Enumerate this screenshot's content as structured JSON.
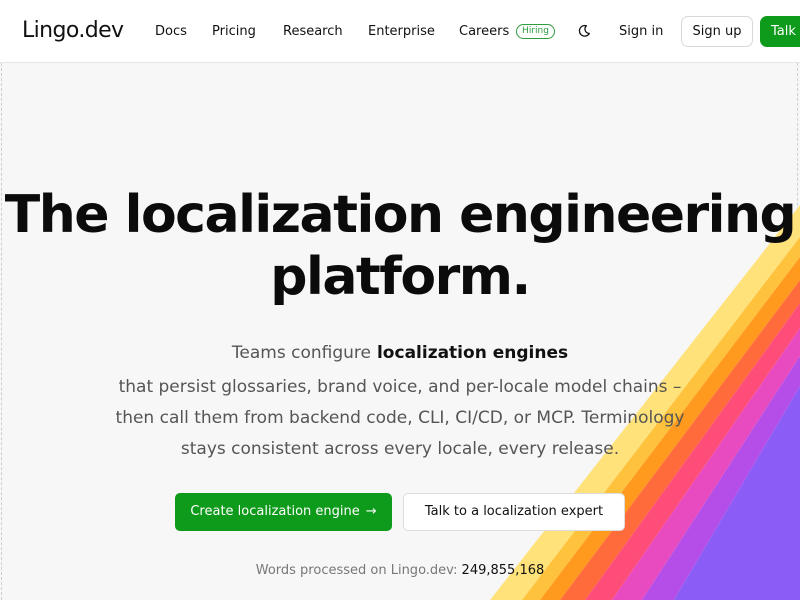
{
  "nav": {
    "logo": "Lingo.dev",
    "links": [
      "Docs",
      "Pricing",
      "Research",
      "Enterprise",
      "Careers"
    ],
    "hiring_badge": "Hiring",
    "sign_in": "Sign in",
    "sign_up": "Sign up",
    "talk": "Talk",
    "theme_icon": "moon-icon"
  },
  "hero": {
    "title_line1": "The localization engineering",
    "title_line2": "platform.",
    "sub_prefix": "Teams configure",
    "sub_highlight": "localization engines",
    "body_lines": [
      "that persist glossaries, brand voice, and per-locale model chains –",
      "then call them from backend code, CLI, CI/CD, or MCP. Terminology",
      "stays consistent across every locale, every release."
    ],
    "primary_cta": "Create localization engine",
    "primary_cta_icon": "arrow-right-icon",
    "secondary_cta": "Talk to a localization expert",
    "words_label": "Words processed on Lingo.dev:",
    "words_count": "249,855,168"
  },
  "colors": {
    "brand_green": "#0e9a1a",
    "rainbow": [
      "#ffe27a",
      "#ffc23d",
      "#ff9a1f",
      "#ff6b3a",
      "#ff4d7a",
      "#e84bbf",
      "#b54ee8",
      "#8b5cf6"
    ]
  }
}
